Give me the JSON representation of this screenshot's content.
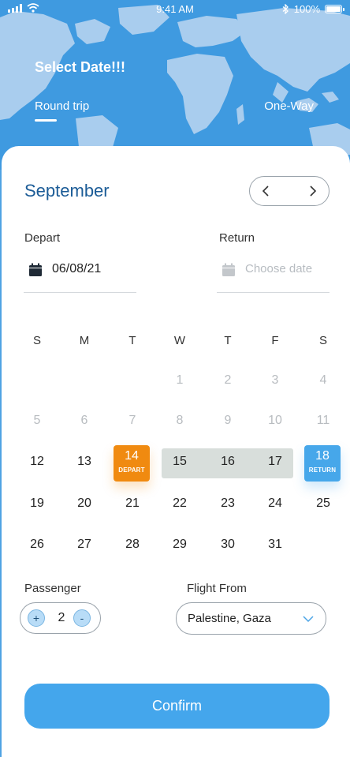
{
  "status_bar": {
    "time": "9:41 AM",
    "battery": "100%"
  },
  "header": {
    "title": "Select Date!!!",
    "tabs": [
      {
        "label": "Round trip",
        "selected": true
      },
      {
        "label": "One-Way",
        "selected": false
      }
    ]
  },
  "calendar": {
    "month": "September",
    "depart_label": "Depart",
    "return_label": "Return",
    "depart_value": "06/08/21",
    "return_placeholder": "Choose date",
    "weekdays": [
      "S",
      "M",
      "T",
      "W",
      "T",
      "F",
      "S"
    ],
    "weeks": [
      [
        null,
        null,
        null,
        "1",
        "2",
        "3",
        "4"
      ],
      [
        "5",
        "6",
        "7",
        "8",
        "9",
        "10",
        "11"
      ],
      [
        "12",
        "13",
        "14",
        "15",
        "16",
        "17",
        "18"
      ],
      [
        "19",
        "20",
        "21",
        "22",
        "23",
        "24",
        "25"
      ],
      [
        "26",
        "27",
        "28",
        "29",
        "30",
        "31",
        null
      ]
    ],
    "muted_weeks": [
      0,
      1
    ],
    "depart_day": "14",
    "depart_tag": "DEPART",
    "return_day": "18",
    "return_tag": "RETURN"
  },
  "passenger": {
    "label": "Passenger",
    "plus": "+",
    "minus": "-",
    "count": "2"
  },
  "flight_from": {
    "label": "Flight From",
    "value": "Palestine, Gaza"
  },
  "confirm_label": "Confirm",
  "colors": {
    "header_blue": "#3f9ae0",
    "map_land": "#a9cdee",
    "depart_orange": "#f08a10",
    "return_blue": "#46a7ea",
    "range_gray": "#d8dedb",
    "month_blue": "#1c5c97",
    "confirm_blue": "#44a6ec"
  }
}
